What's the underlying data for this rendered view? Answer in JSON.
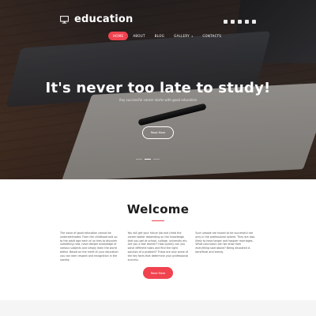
{
  "brand": {
    "name": "education",
    "icon": "monitor-icon"
  },
  "social_icons": [
    "facebook-icon",
    "google-plus-icon",
    "instagram-icon",
    "twitter-icon",
    "vimeo-icon"
  ],
  "nav": {
    "items": [
      {
        "label": "HOME",
        "active": true
      },
      {
        "label": "ABOUT",
        "active": false
      },
      {
        "label": "BLOG",
        "active": false
      },
      {
        "label": "GALLERY",
        "active": false,
        "has_dropdown": true
      },
      {
        "label": "CONTACTS",
        "active": false
      }
    ],
    "dropdown_caret": "▾"
  },
  "hero": {
    "title": "It's never too late to study!",
    "subtitle": "Any successful career starts with good education",
    "button_label": "Read More",
    "slides": 3,
    "active_slide": 1
  },
  "welcome": {
    "title": "Welcome",
    "columns": [
      "The value of good education cannot be underestimated. From the childhood and up to the adult age each of us tries to discover something new, have deeper knowledge of various subjects and simply learn the world better. Based on the merit of your education you can earn respect and recognition in the society.",
      "You will get your future job and climb the career ladder depending on the knowledge that you get at school, college, university etc. Are you a fast learner? How quickly can you solve different tasks and find the right solution of a problem? These are only some of the key facts that determine your professional success.",
      "Such people are known to be successful not only in the professional sphere. They are also likely to have longer and happier marriages. What conclusion can we draw from everything said above? Being educated is beneficial and trendy."
    ],
    "button_label": "Read More"
  },
  "colors": {
    "accent": "#f0434f",
    "hero_overlay": "#141214",
    "text_dark": "#1d1d1d",
    "text_body": "#555555",
    "band": "#f5f5f5"
  }
}
